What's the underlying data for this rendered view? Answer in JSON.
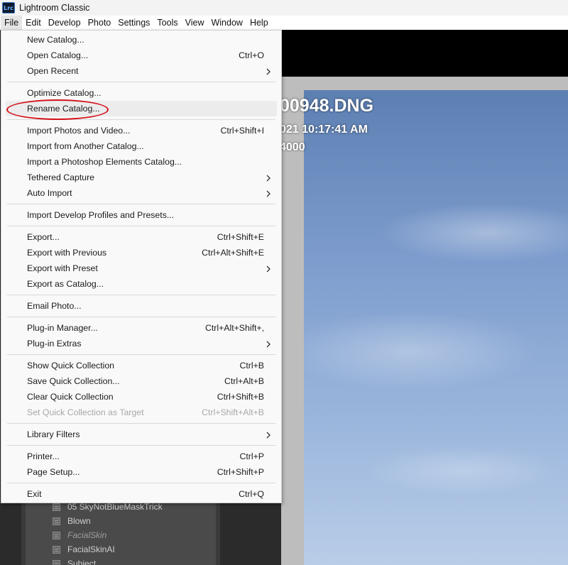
{
  "window": {
    "app_icon": "Lrc",
    "title": "Lightroom Classic"
  },
  "menubar": [
    "File",
    "Edit",
    "Develop",
    "Photo",
    "Settings",
    "Tools",
    "View",
    "Window",
    "Help"
  ],
  "photo_overlay": {
    "filename": "00948.DNG",
    "datetime": "021 10:17:41 AM",
    "iso": "4000"
  },
  "collections": [
    {
      "label": "05 SkyNotBlueMaskTrick",
      "italic": false
    },
    {
      "label": "Blown",
      "italic": false
    },
    {
      "label": "FacialSkin",
      "italic": true
    },
    {
      "label": "FacialSkinAI",
      "italic": false
    },
    {
      "label": "Subject",
      "italic": false
    }
  ],
  "file_menu": [
    {
      "label": "New Catalog..."
    },
    {
      "label": "Open Catalog...",
      "shortcut": "Ctrl+O"
    },
    {
      "label": "Open Recent",
      "submenu": true
    },
    {
      "separator": true
    },
    {
      "label": "Optimize Catalog..."
    },
    {
      "label": "Rename Catalog...",
      "highlighted": true
    },
    {
      "separator": true
    },
    {
      "label": "Import Photos and Video...",
      "shortcut": "Ctrl+Shift+I"
    },
    {
      "label": "Import from Another Catalog..."
    },
    {
      "label": "Import a Photoshop Elements Catalog..."
    },
    {
      "label": "Tethered Capture",
      "submenu": true
    },
    {
      "label": "Auto Import",
      "submenu": true
    },
    {
      "separator": true
    },
    {
      "label": "Import Develop Profiles and Presets..."
    },
    {
      "separator": true
    },
    {
      "label": "Export...",
      "shortcut": "Ctrl+Shift+E"
    },
    {
      "label": "Export with Previous",
      "shortcut": "Ctrl+Alt+Shift+E"
    },
    {
      "label": "Export with Preset",
      "submenu": true
    },
    {
      "label": "Export as Catalog..."
    },
    {
      "separator": true
    },
    {
      "label": "Email Photo..."
    },
    {
      "separator": true
    },
    {
      "label": "Plug-in Manager...",
      "shortcut": "Ctrl+Alt+Shift+,"
    },
    {
      "label": "Plug-in Extras",
      "submenu": true
    },
    {
      "separator": true
    },
    {
      "label": "Show Quick Collection",
      "shortcut": "Ctrl+B"
    },
    {
      "label": "Save Quick Collection...",
      "shortcut": "Ctrl+Alt+B"
    },
    {
      "label": "Clear Quick Collection",
      "shortcut": "Ctrl+Shift+B"
    },
    {
      "label": "Set Quick Collection as Target",
      "shortcut": "Ctrl+Shift+Alt+B",
      "disabled": true
    },
    {
      "separator": true
    },
    {
      "label": "Library Filters",
      "submenu": true
    },
    {
      "separator": true
    },
    {
      "label": "Printer...",
      "shortcut": "Ctrl+P"
    },
    {
      "label": "Page Setup...",
      "shortcut": "Ctrl+Shift+P"
    },
    {
      "separator": true
    },
    {
      "label": "Exit",
      "shortcut": "Ctrl+Q"
    }
  ],
  "annotation": {
    "color": "#d4131c"
  }
}
